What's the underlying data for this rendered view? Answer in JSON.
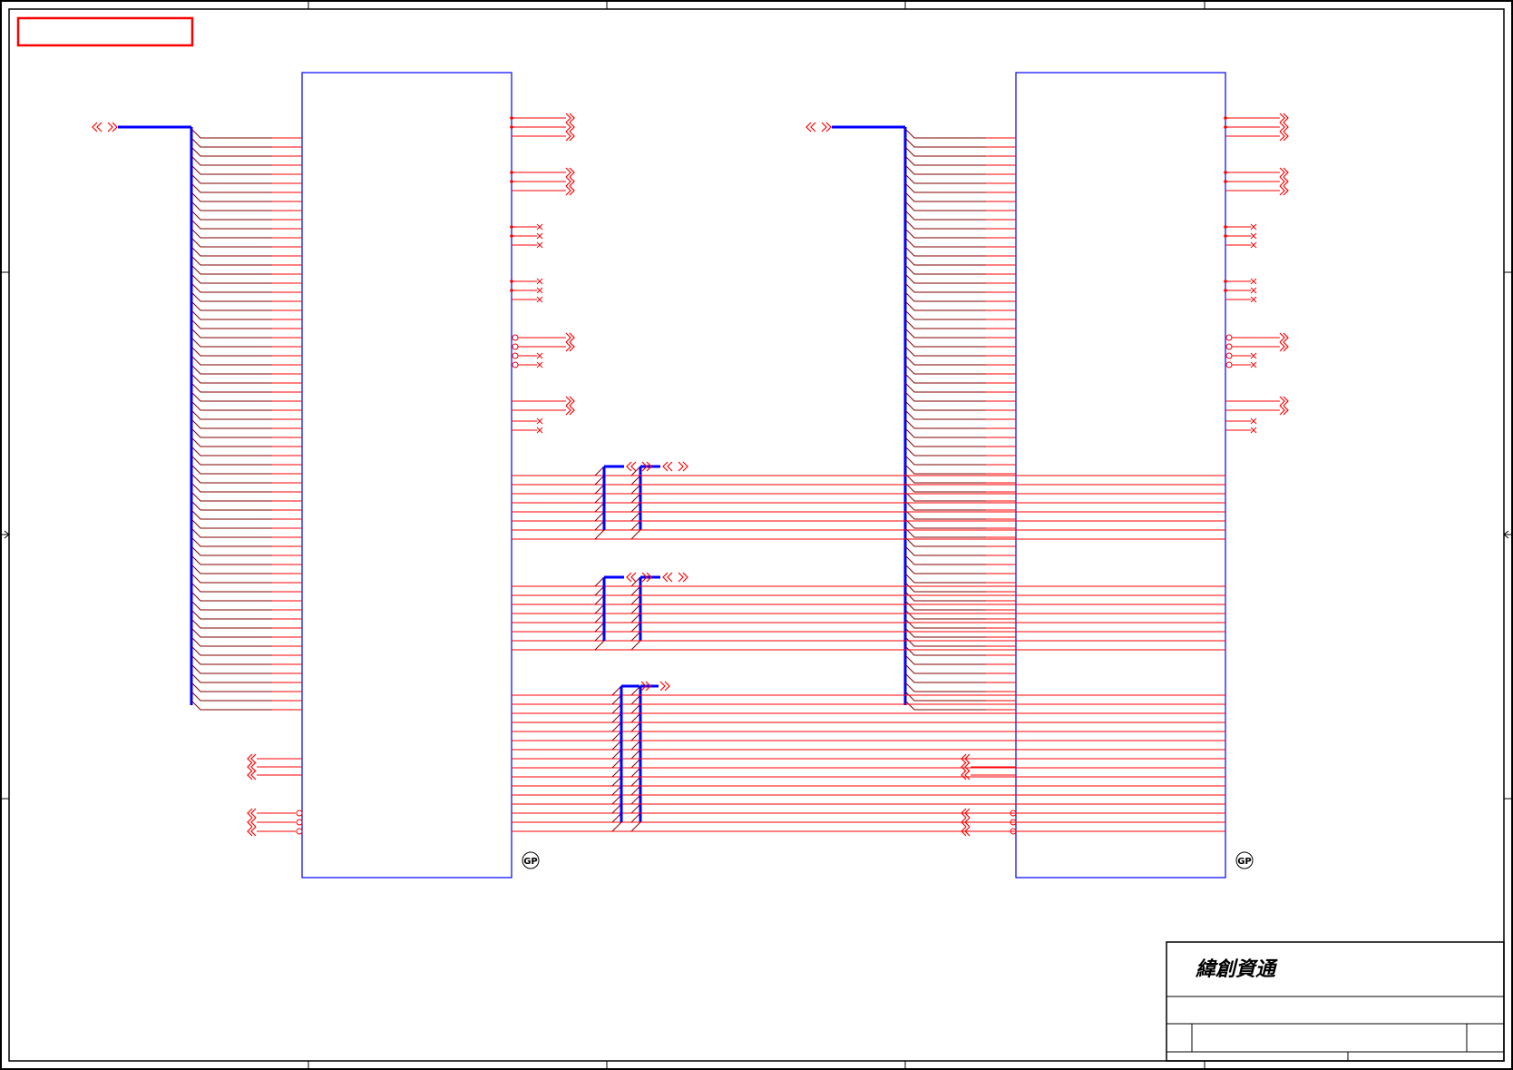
{
  "document": {
    "kind": "schematic-sheet",
    "colors": {
      "frame": "#000000",
      "component": "#0000ff",
      "wire": "#ff0000",
      "entry": "#800000",
      "bus": "#0000ff",
      "header_box": "#ff0000"
    }
  },
  "title_block": {
    "company": "緯創資通"
  },
  "components": [
    {
      "id": "left-chip",
      "gp_mark": "GP"
    },
    {
      "id": "right-chip",
      "gp_mark": "GP"
    }
  ]
}
